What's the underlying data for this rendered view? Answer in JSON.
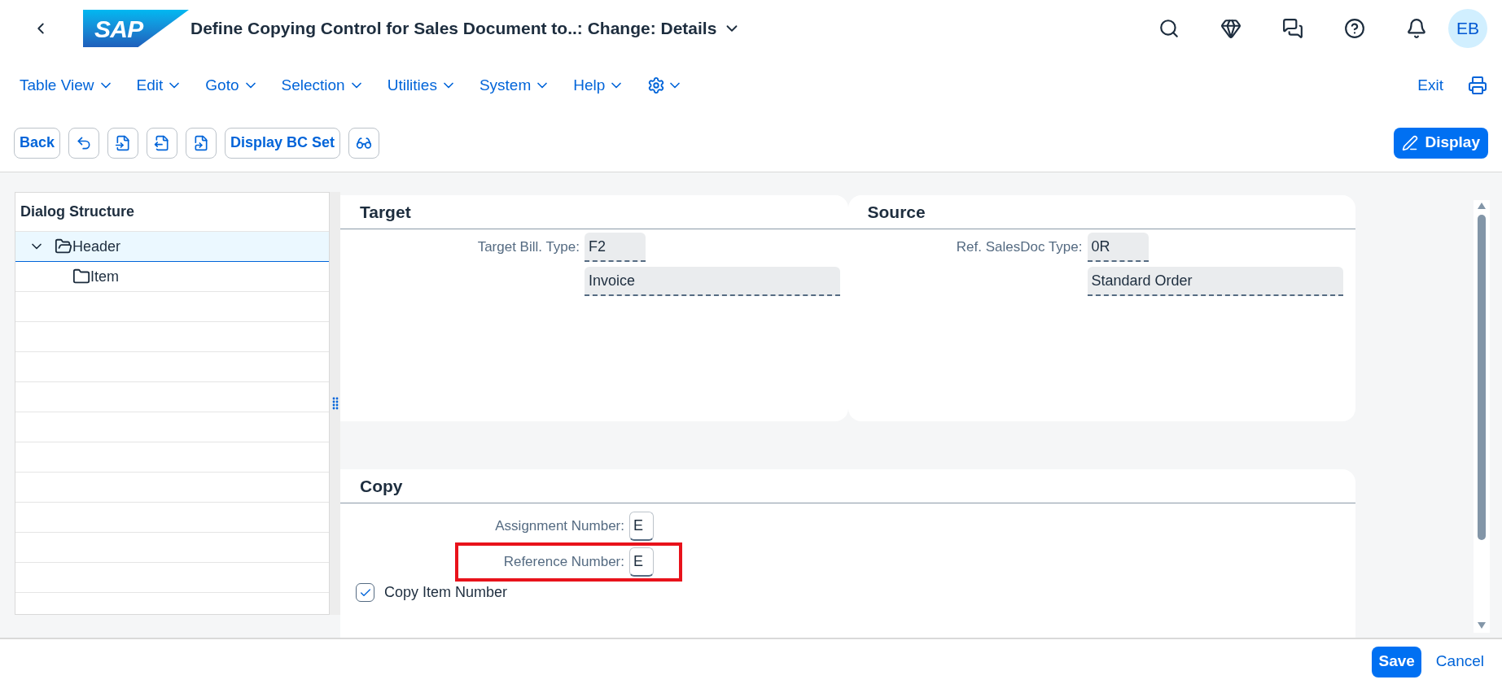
{
  "shell": {
    "logo": "SAP",
    "title": "Define Copying Control for Sales Document to..: Change: Details",
    "avatar": "EB"
  },
  "menu": [
    "Table View",
    "Edit",
    "Goto",
    "Selection",
    "Utilities",
    "System",
    "Help"
  ],
  "exit": "Exit",
  "toolbar": {
    "back": "Back",
    "bc_set": "Display BC Set",
    "display": "Display"
  },
  "tree": {
    "title": "Dialog Structure",
    "items": [
      {
        "label": "Header",
        "selected": true,
        "expanded": true,
        "children": [
          {
            "label": "Item",
            "selected": false
          }
        ]
      }
    ]
  },
  "target": {
    "title": "Target",
    "label": "Target Bill. Type:",
    "value": "F2",
    "description": "Invoice"
  },
  "source": {
    "title": "Source",
    "label": "Ref. SalesDoc Type:",
    "value": "0R",
    "description": "Standard Order"
  },
  "copy": {
    "title": "Copy",
    "fields": [
      {
        "label": "Assignment Number:",
        "value": "E",
        "highlighted": false
      },
      {
        "label": "Reference Number:",
        "value": "E",
        "highlighted": true
      }
    ],
    "checkbox": {
      "label": "Copy Item Number",
      "checked": true
    }
  },
  "footer": {
    "save": "Save",
    "cancel": "Cancel"
  }
}
